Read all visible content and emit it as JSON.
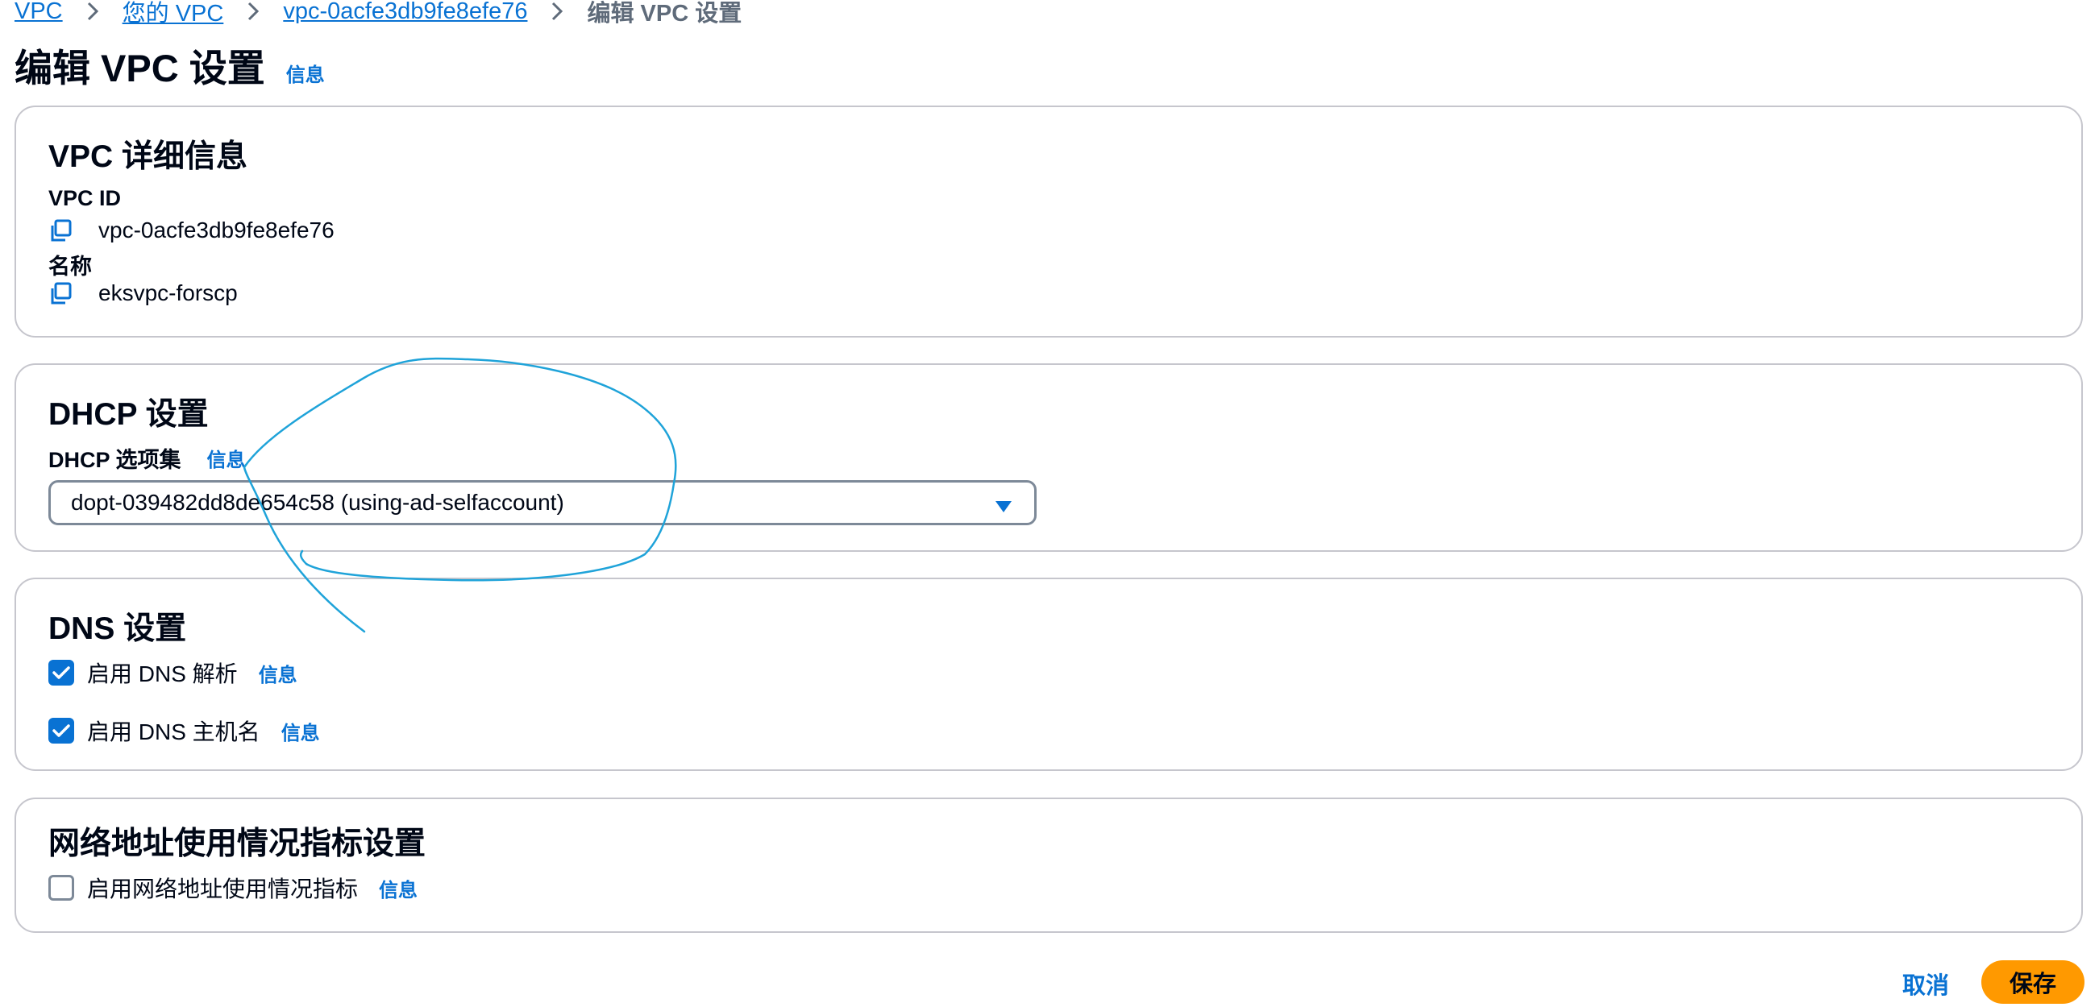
{
  "breadcrumb": {
    "items": [
      "VPC",
      "您的 VPC",
      "vpc-0acfe3db9fe8efe76"
    ],
    "current": "编辑 VPC 设置"
  },
  "header": {
    "title": "编辑 VPC 设置",
    "info": "信息"
  },
  "vpc_details": {
    "title": "VPC 详细信息",
    "vpc_id_label": "VPC ID",
    "vpc_id_value": "vpc-0acfe3db9fe8efe76",
    "name_label": "名称",
    "name_value": "eksvpc-forscp"
  },
  "dhcp": {
    "title": "DHCP 设置",
    "option_set_label": "DHCP 选项集",
    "info": "信息",
    "selected_value": "dopt-039482dd8de654c58 (using-ad-selfaccount)"
  },
  "dns": {
    "title": "DNS 设置",
    "resolution_label": "启用 DNS 解析",
    "resolution_checked": true,
    "hostnames_label": "启用 DNS 主机名",
    "hostnames_checked": true,
    "info": "信息"
  },
  "network_usage": {
    "title": "网络地址使用情况指标设置",
    "metrics_label": "启用网络地址使用情况指标",
    "metrics_checked": false,
    "info": "信息"
  },
  "footer": {
    "cancel_label": "取消",
    "save_label": "保存"
  },
  "colors": {
    "link": "#0972d3",
    "primary_button": "#ff9900",
    "border": "#c6c6cd",
    "annotation_stroke": "#1fa3d9"
  },
  "icons": {
    "breadcrumb_separator": "chevron-right-icon",
    "copy": "copy-icon",
    "select_caret": "caret-down-icon",
    "check": "check-icon"
  }
}
